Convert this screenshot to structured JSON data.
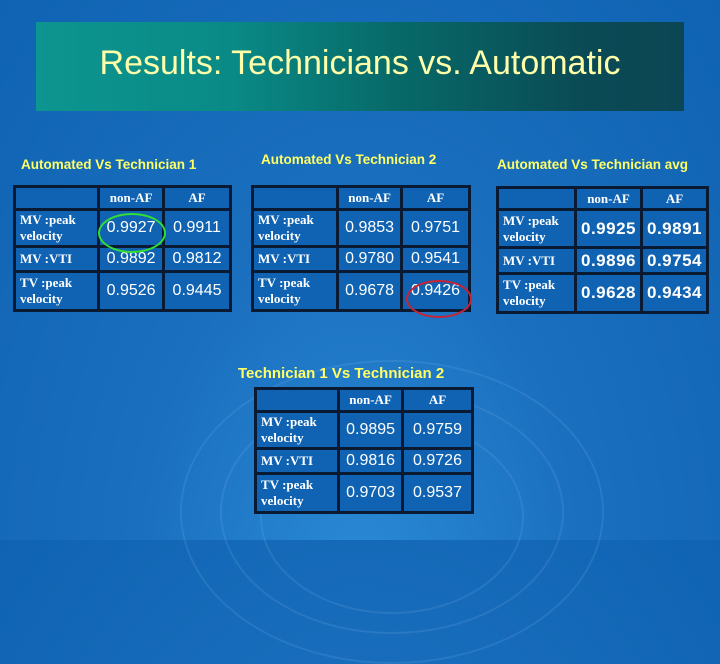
{
  "slide": {
    "title": "Results: Technicians vs. Automatic",
    "highlight_colors": {
      "green_ring": "#33dd33",
      "red_ring": "#cc2233"
    }
  },
  "tables": [
    {
      "caption": "Automated Vs Technician 1",
      "headers": [
        "",
        "non-AF",
        "AF"
      ],
      "rows": [
        {
          "label": "MV :peak velocity",
          "non_af": "0.9927",
          "af": "0.9911"
        },
        {
          "label": "MV :VTI",
          "non_af": "0.9892",
          "af": "0.9812"
        },
        {
          "label": "TV :peak velocity",
          "non_af": "0.9526",
          "af": "0.9445"
        }
      ],
      "highlighted_cell": {
        "row": 0,
        "column": "non_af",
        "marker": "green circle"
      }
    },
    {
      "caption": "Automated Vs Technician 2",
      "headers": [
        "",
        "non-AF",
        "AF"
      ],
      "rows": [
        {
          "label": "MV :peak velocity",
          "non_af": "0.9853",
          "af": "0.9751"
        },
        {
          "label": "MV :VTI",
          "non_af": "0.9780",
          "af": "0.9541"
        },
        {
          "label": "TV :peak velocity",
          "non_af": "0.9678",
          "af": "0.9426"
        }
      ],
      "highlighted_cell": {
        "row": 2,
        "column": "af",
        "marker": "red circle"
      }
    },
    {
      "caption": "Automated Vs Technician avg",
      "headers": [
        "",
        "non-AF",
        "AF"
      ],
      "rows": [
        {
          "label": "MV :peak velocity",
          "non_af": "0.9925",
          "af": "0.9891"
        },
        {
          "label": "MV :VTI",
          "non_af": "0.9896",
          "af": "0.9754"
        },
        {
          "label": "TV :peak velocity",
          "non_af": "0.9628",
          "af": "0.9434"
        }
      ]
    },
    {
      "caption": "Technician 1 Vs Technician 2",
      "headers": [
        "",
        "non-AF",
        "AF"
      ],
      "rows": [
        {
          "label": "MV :peak velocity",
          "non_af": "0.9895",
          "af": "0.9759"
        },
        {
          "label": "MV :VTI",
          "non_af": "0.9816",
          "af": "0.9726"
        },
        {
          "label": "TV :peak velocity",
          "non_af": "0.9703",
          "af": "0.9537"
        }
      ]
    }
  ]
}
